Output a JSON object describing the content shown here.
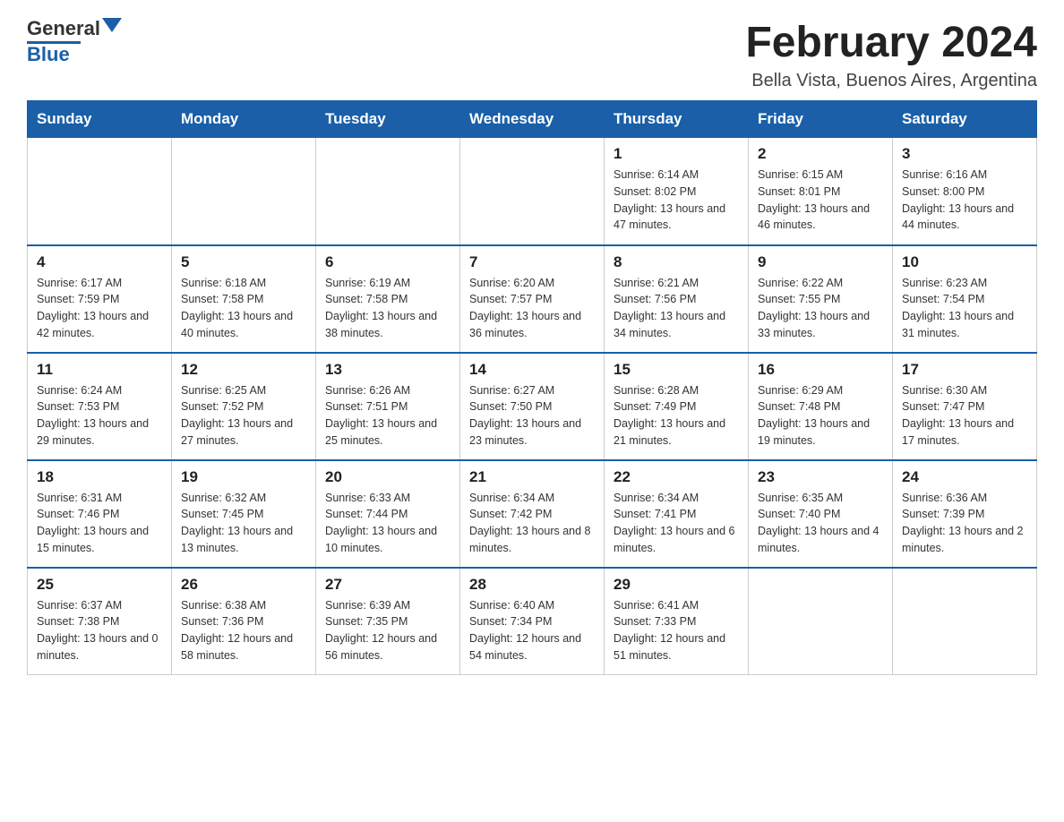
{
  "header": {
    "logo_general": "General",
    "logo_blue": "Blue",
    "month_year": "February 2024",
    "location": "Bella Vista, Buenos Aires, Argentina"
  },
  "days_of_week": [
    "Sunday",
    "Monday",
    "Tuesday",
    "Wednesday",
    "Thursday",
    "Friday",
    "Saturday"
  ],
  "weeks": [
    [
      {
        "day": "",
        "info": ""
      },
      {
        "day": "",
        "info": ""
      },
      {
        "day": "",
        "info": ""
      },
      {
        "day": "",
        "info": ""
      },
      {
        "day": "1",
        "info": "Sunrise: 6:14 AM\nSunset: 8:02 PM\nDaylight: 13 hours\nand 47 minutes."
      },
      {
        "day": "2",
        "info": "Sunrise: 6:15 AM\nSunset: 8:01 PM\nDaylight: 13 hours\nand 46 minutes."
      },
      {
        "day": "3",
        "info": "Sunrise: 6:16 AM\nSunset: 8:00 PM\nDaylight: 13 hours\nand 44 minutes."
      }
    ],
    [
      {
        "day": "4",
        "info": "Sunrise: 6:17 AM\nSunset: 7:59 PM\nDaylight: 13 hours\nand 42 minutes."
      },
      {
        "day": "5",
        "info": "Sunrise: 6:18 AM\nSunset: 7:58 PM\nDaylight: 13 hours\nand 40 minutes."
      },
      {
        "day": "6",
        "info": "Sunrise: 6:19 AM\nSunset: 7:58 PM\nDaylight: 13 hours\nand 38 minutes."
      },
      {
        "day": "7",
        "info": "Sunrise: 6:20 AM\nSunset: 7:57 PM\nDaylight: 13 hours\nand 36 minutes."
      },
      {
        "day": "8",
        "info": "Sunrise: 6:21 AM\nSunset: 7:56 PM\nDaylight: 13 hours\nand 34 minutes."
      },
      {
        "day": "9",
        "info": "Sunrise: 6:22 AM\nSunset: 7:55 PM\nDaylight: 13 hours\nand 33 minutes."
      },
      {
        "day": "10",
        "info": "Sunrise: 6:23 AM\nSunset: 7:54 PM\nDaylight: 13 hours\nand 31 minutes."
      }
    ],
    [
      {
        "day": "11",
        "info": "Sunrise: 6:24 AM\nSunset: 7:53 PM\nDaylight: 13 hours\nand 29 minutes."
      },
      {
        "day": "12",
        "info": "Sunrise: 6:25 AM\nSunset: 7:52 PM\nDaylight: 13 hours\nand 27 minutes."
      },
      {
        "day": "13",
        "info": "Sunrise: 6:26 AM\nSunset: 7:51 PM\nDaylight: 13 hours\nand 25 minutes."
      },
      {
        "day": "14",
        "info": "Sunrise: 6:27 AM\nSunset: 7:50 PM\nDaylight: 13 hours\nand 23 minutes."
      },
      {
        "day": "15",
        "info": "Sunrise: 6:28 AM\nSunset: 7:49 PM\nDaylight: 13 hours\nand 21 minutes."
      },
      {
        "day": "16",
        "info": "Sunrise: 6:29 AM\nSunset: 7:48 PM\nDaylight: 13 hours\nand 19 minutes."
      },
      {
        "day": "17",
        "info": "Sunrise: 6:30 AM\nSunset: 7:47 PM\nDaylight: 13 hours\nand 17 minutes."
      }
    ],
    [
      {
        "day": "18",
        "info": "Sunrise: 6:31 AM\nSunset: 7:46 PM\nDaylight: 13 hours\nand 15 minutes."
      },
      {
        "day": "19",
        "info": "Sunrise: 6:32 AM\nSunset: 7:45 PM\nDaylight: 13 hours\nand 13 minutes."
      },
      {
        "day": "20",
        "info": "Sunrise: 6:33 AM\nSunset: 7:44 PM\nDaylight: 13 hours\nand 10 minutes."
      },
      {
        "day": "21",
        "info": "Sunrise: 6:34 AM\nSunset: 7:42 PM\nDaylight: 13 hours\nand 8 minutes."
      },
      {
        "day": "22",
        "info": "Sunrise: 6:34 AM\nSunset: 7:41 PM\nDaylight: 13 hours\nand 6 minutes."
      },
      {
        "day": "23",
        "info": "Sunrise: 6:35 AM\nSunset: 7:40 PM\nDaylight: 13 hours\nand 4 minutes."
      },
      {
        "day": "24",
        "info": "Sunrise: 6:36 AM\nSunset: 7:39 PM\nDaylight: 13 hours\nand 2 minutes."
      }
    ],
    [
      {
        "day": "25",
        "info": "Sunrise: 6:37 AM\nSunset: 7:38 PM\nDaylight: 13 hours\nand 0 minutes."
      },
      {
        "day": "26",
        "info": "Sunrise: 6:38 AM\nSunset: 7:36 PM\nDaylight: 12 hours\nand 58 minutes."
      },
      {
        "day": "27",
        "info": "Sunrise: 6:39 AM\nSunset: 7:35 PM\nDaylight: 12 hours\nand 56 minutes."
      },
      {
        "day": "28",
        "info": "Sunrise: 6:40 AM\nSunset: 7:34 PM\nDaylight: 12 hours\nand 54 minutes."
      },
      {
        "day": "29",
        "info": "Sunrise: 6:41 AM\nSunset: 7:33 PM\nDaylight: 12 hours\nand 51 minutes."
      },
      {
        "day": "",
        "info": ""
      },
      {
        "day": "",
        "info": ""
      }
    ]
  ]
}
